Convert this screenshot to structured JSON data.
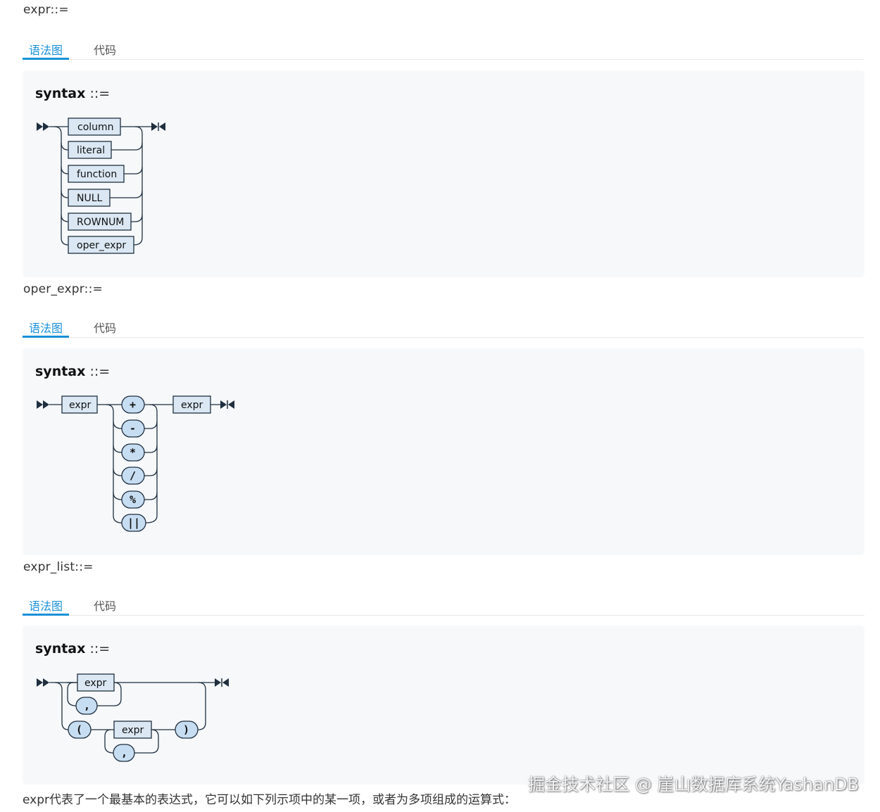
{
  "sections": [
    {
      "heading": "expr::=",
      "tabs": [
        {
          "label": "语法图"
        },
        {
          "label": "代码"
        }
      ],
      "syntax": {
        "name": "syntax",
        "op": "::="
      },
      "items": [
        "column",
        "literal",
        "function",
        "NULL",
        "ROWNUM",
        "oper_expr"
      ]
    },
    {
      "heading": "oper_expr::=",
      "tabs": [
        {
          "label": "语法图"
        },
        {
          "label": "代码"
        }
      ],
      "syntax": {
        "name": "syntax",
        "op": "::="
      },
      "left": "expr",
      "right": "expr",
      "operators": [
        "+",
        "-",
        "*",
        "/",
        "%",
        "||"
      ]
    },
    {
      "heading": "expr_list::=",
      "tabs": [
        {
          "label": "语法图"
        },
        {
          "label": "代码"
        }
      ],
      "syntax": {
        "name": "syntax",
        "op": "::="
      },
      "expr": "expr",
      "comma": ",",
      "open_paren": "(",
      "close_paren": ")"
    }
  ],
  "footer": "expr代表了一个最基本的表达式，它可以如下列示项中的某一项，或者为多项组成的运算式：",
  "watermark": "掘金技术社区 @ 崖山数据库系统YashanDB",
  "colors": {
    "accent": "#1890d8",
    "panel": "#f6f8fa",
    "box": "#dbe8f4",
    "terminal": "#c7ddf2"
  }
}
